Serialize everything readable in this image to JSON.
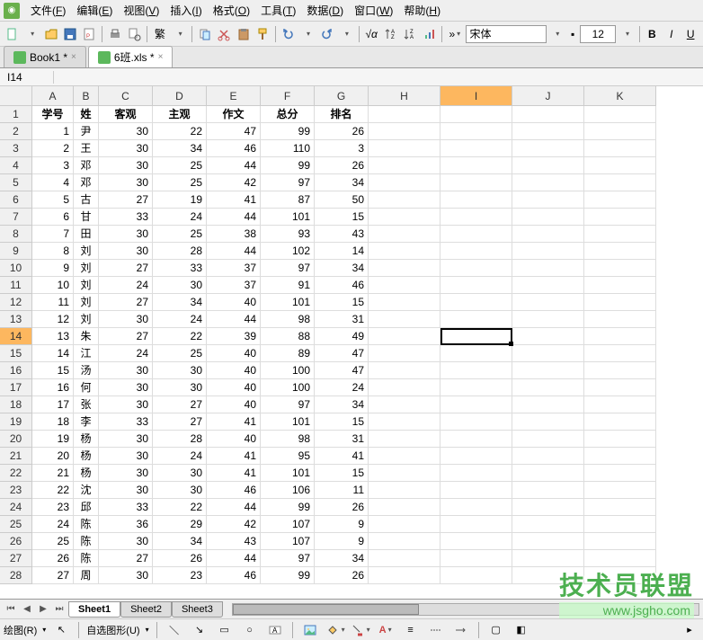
{
  "menubar": {
    "items": [
      {
        "label": "文件(F)",
        "u": "F"
      },
      {
        "label": "编辑(E)",
        "u": "E"
      },
      {
        "label": "视图(V)",
        "u": "V"
      },
      {
        "label": "插入(I)",
        "u": "I"
      },
      {
        "label": "格式(O)",
        "u": "O"
      },
      {
        "label": "工具(T)",
        "u": "T"
      },
      {
        "label": "数据(D)",
        "u": "D"
      },
      {
        "label": "窗口(W)",
        "u": "W"
      },
      {
        "label": "帮助(H)",
        "u": "H"
      }
    ]
  },
  "toolbar1": {
    "font_name": "宋体",
    "font_size": "12"
  },
  "doc_tabs": [
    {
      "label": "Book1 *",
      "active": false
    },
    {
      "label": "6班.xls *",
      "active": true
    }
  ],
  "cell_ref": "I14",
  "columns": [
    "A",
    "B",
    "C",
    "D",
    "E",
    "F",
    "G",
    "H",
    "I",
    "J",
    "K"
  ],
  "headers_row": [
    "学号",
    "姓",
    "客观",
    "主观",
    "作文",
    "总分",
    "排名"
  ],
  "rows": [
    [
      1,
      "尹",
      30,
      22,
      47,
      99,
      26
    ],
    [
      2,
      "王",
      30,
      34,
      46,
      110,
      3
    ],
    [
      3,
      "邓",
      30,
      25,
      44,
      99,
      26
    ],
    [
      4,
      "邓",
      30,
      25,
      42,
      97,
      34
    ],
    [
      5,
      "古",
      27,
      19,
      41,
      87,
      50
    ],
    [
      6,
      "甘",
      33,
      24,
      44,
      101,
      15
    ],
    [
      7,
      "田",
      30,
      25,
      38,
      93,
      43
    ],
    [
      8,
      "刘",
      30,
      28,
      44,
      102,
      14
    ],
    [
      9,
      "刘",
      27,
      33,
      37,
      97,
      34
    ],
    [
      10,
      "刘",
      24,
      30,
      37,
      91,
      46
    ],
    [
      11,
      "刘",
      27,
      34,
      40,
      101,
      15
    ],
    [
      12,
      "刘",
      30,
      24,
      44,
      98,
      31
    ],
    [
      13,
      "朱",
      27,
      22,
      39,
      88,
      49
    ],
    [
      14,
      "江",
      24,
      25,
      40,
      89,
      47
    ],
    [
      15,
      "汤",
      30,
      30,
      40,
      100,
      "47"
    ],
    [
      16,
      "何",
      30,
      30,
      40,
      100,
      24
    ],
    [
      17,
      "张",
      30,
      27,
      40,
      97,
      34
    ],
    [
      18,
      "李",
      33,
      27,
      41,
      101,
      15
    ],
    [
      19,
      "杨",
      30,
      28,
      40,
      98,
      31
    ],
    [
      20,
      "杨",
      30,
      24,
      41,
      95,
      41
    ],
    [
      21,
      "杨",
      30,
      30,
      41,
      101,
      15
    ],
    [
      22,
      "沈",
      30,
      30,
      46,
      106,
      11
    ],
    [
      23,
      "邱",
      33,
      22,
      44,
      99,
      26
    ],
    [
      24,
      "陈",
      36,
      29,
      42,
      107,
      9
    ],
    [
      25,
      "陈",
      30,
      34,
      43,
      107,
      9
    ],
    [
      26,
      "陈",
      27,
      26,
      44,
      97,
      34
    ],
    [
      27,
      "周",
      30,
      23,
      46,
      99,
      26
    ]
  ],
  "selected_row": 14,
  "selected_col": "I",
  "sheet_tabs": [
    {
      "label": "Sheet1",
      "active": true
    },
    {
      "label": "Sheet2",
      "active": false
    },
    {
      "label": "Sheet3",
      "active": false
    }
  ],
  "bottom_bar": {
    "draw_label": "绘图(R)",
    "autoshape_label": "自选图形(U)"
  },
  "watermark": {
    "title": "技术员联盟",
    "url": "www.jsgho.com"
  }
}
